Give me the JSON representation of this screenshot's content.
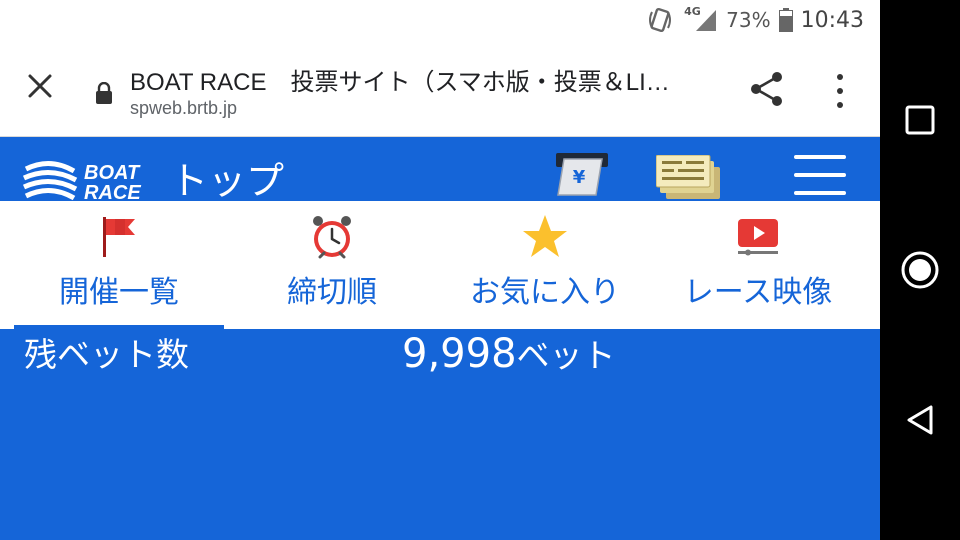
{
  "status": {
    "network": "4G",
    "battery": "73%",
    "time": "10:43"
  },
  "browser": {
    "title": "BOAT RACE　投票サイト（スマホ版・投票＆LI…",
    "url": "spweb.brtb.jp"
  },
  "site": {
    "logo_line1": "BOAT",
    "logo_line2": "RACE",
    "title": "トップ",
    "bet_symbol": "¥"
  },
  "tabs": [
    {
      "label": "開催一覧",
      "icon": "flag-icon",
      "active": true
    },
    {
      "label": "締切順",
      "icon": "alarm-clock-icon",
      "active": false
    },
    {
      "label": "お気に入り",
      "icon": "star-icon",
      "active": false
    },
    {
      "label": "レース映像",
      "icon": "video-icon",
      "active": false
    }
  ],
  "remaining": {
    "label": "残ベット数",
    "value": "9,998",
    "unit": "ベット"
  },
  "colors": {
    "brand_blue": "#1565d8",
    "flag_red": "#e53935",
    "star_yellow": "#fbc02d"
  }
}
